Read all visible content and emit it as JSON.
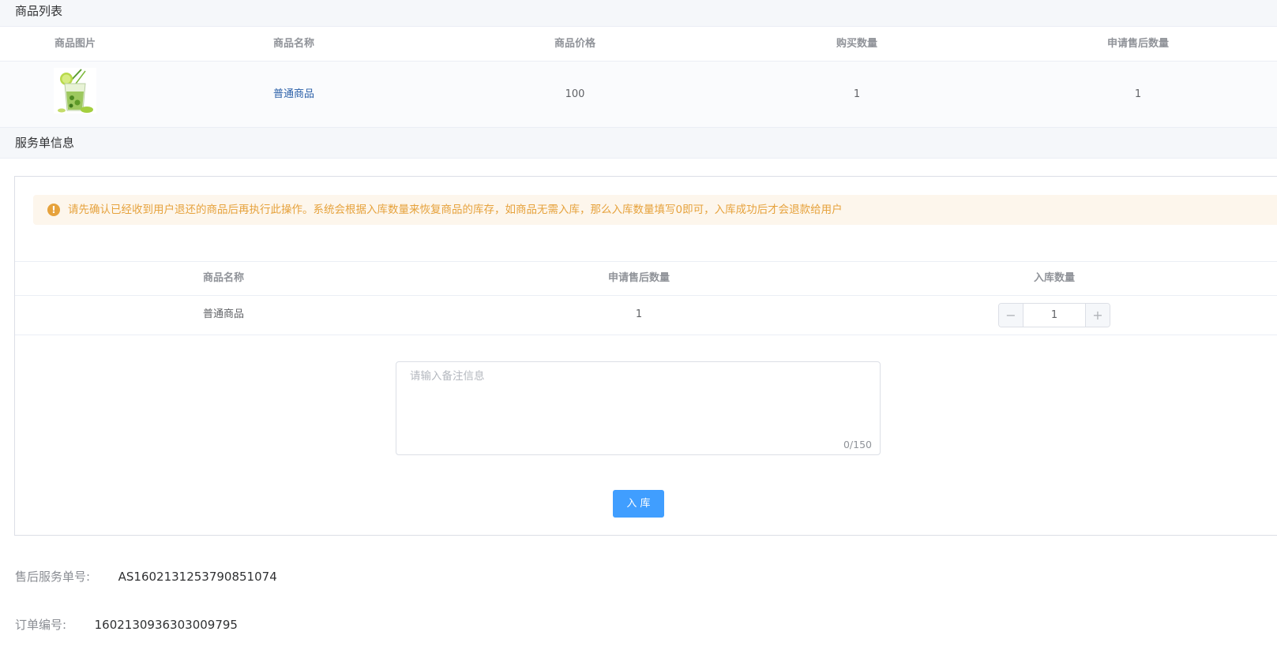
{
  "goods_section": {
    "title": "商品列表",
    "columns": [
      "商品图片",
      "商品名称",
      "商品价格",
      "购买数量",
      "申请售后数量"
    ],
    "row": {
      "image_icon": "drink-glass-image",
      "name": "普通商品",
      "price": "100",
      "quantity": "1",
      "aftersale_quantity": "1"
    }
  },
  "service_section": {
    "title": "服务单信息",
    "alert": {
      "icon": "warning-icon",
      "icon_glyph": "!",
      "text": "请先确认已经收到用户退还的商品后再执行此操作。系统会根据入库数量来恢复商品的库存，如商品无需入库，那么入库数量填写0即可，入库成功后才会退款给用户"
    },
    "columns": [
      "商品名称",
      "申请售后数量",
      "入库数量"
    ],
    "row": {
      "name": "普通商品",
      "aftersale_quantity": "1",
      "stock_in_quantity": "1"
    },
    "stepper": {
      "minus": "−",
      "plus": "+"
    },
    "remark": {
      "placeholder": "请输入备注信息",
      "value": "",
      "count": "0/150"
    },
    "submit_label": "入 库"
  },
  "info": {
    "service_no_label": "售后服务单号:",
    "service_no": "AS1602131253790851074",
    "order_no_label": "订单编号:",
    "order_no": "1602130936303009795"
  },
  "colors": {
    "primary": "#409eff",
    "warning": "#e6a23c",
    "warning_bg": "#fdf6ec",
    "link": "#2a5fa8"
  }
}
